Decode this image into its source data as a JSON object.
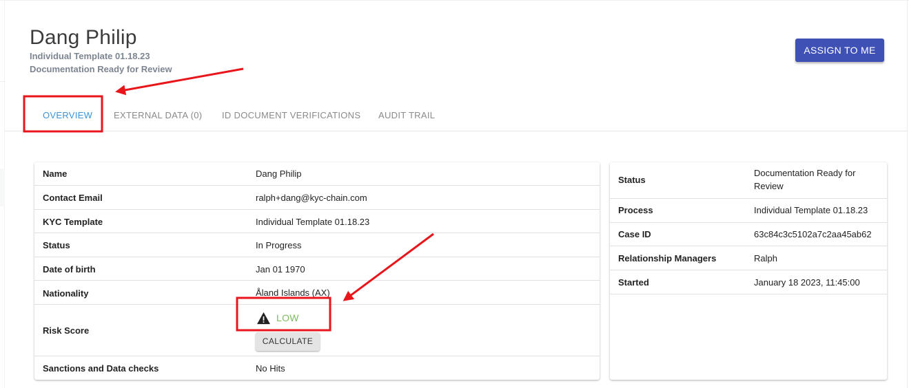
{
  "header": {
    "title": "Dang Philip",
    "template": "Individual Template 01.18.23",
    "status": "Documentation Ready for Review",
    "assign_button": "ASSIGN TO ME"
  },
  "tabs": [
    {
      "label": "OVERVIEW",
      "active": true
    },
    {
      "label": "EXTERNAL DATA (0)",
      "active": false
    },
    {
      "label": "ID DOCUMENT VERIFICATIONS",
      "active": false
    },
    {
      "label": "AUDIT TRAIL",
      "active": false
    }
  ],
  "details": [
    {
      "label": "Name",
      "value": "Dang Philip"
    },
    {
      "label": "Contact Email",
      "value": "ralph+dang@kyc-chain.com"
    },
    {
      "label": "KYC Template",
      "value": "Individual Template 01.18.23"
    },
    {
      "label": "Status",
      "value": "In Progress"
    },
    {
      "label": "Date of birth",
      "value": "Jan 01 1970"
    },
    {
      "label": "Nationality",
      "value": "Åland Islands (AX)"
    },
    {
      "label": "Risk Score",
      "risk_value": "LOW",
      "risk_icon": "warning-triangle-icon",
      "calculate_button": "CALCULATE"
    },
    {
      "label": "Sanctions and Data checks",
      "value": "No Hits"
    }
  ],
  "summary": [
    {
      "label": "Status",
      "value": "Documentation Ready for Review"
    },
    {
      "label": "Process",
      "value": "Individual Template 01.18.23"
    },
    {
      "label": "Case ID",
      "value": "63c84c3c5102a7c2aa45ab62"
    },
    {
      "label": "Relationship Managers",
      "value": "Ralph"
    },
    {
      "label": "Started",
      "value": "January 18 2023, 11:45:00"
    }
  ],
  "colors": {
    "accent": "#3f51b5",
    "active_tab": "#3b94d9",
    "risk_low": "#7dbb5e",
    "annotation": "#e8151b"
  }
}
